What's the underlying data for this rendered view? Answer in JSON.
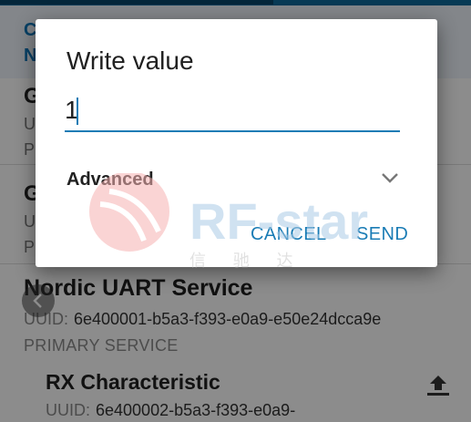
{
  "header": {
    "line1_fragment": "C",
    "line2_fragment": "N"
  },
  "background_services": [
    {
      "name_fragment": "G",
      "uuid_fragment": "U",
      "type_fragment": "P"
    },
    {
      "name_fragment": "G",
      "uuid_fragment": "U",
      "type_fragment": "P"
    }
  ],
  "service": {
    "name": "Nordic UART Service",
    "uuid_label": "UUID:",
    "uuid": "6e400001-b5a3-f393-e0a9-e50e24dcca9e",
    "type": "PRIMARY SERVICE"
  },
  "characteristic": {
    "name": "RX Characteristic",
    "uuid_label": "UUID:",
    "uuid": "6e400002-b5a3-f393-e0a9-"
  },
  "dialog": {
    "title": "Write value",
    "input_value": "1",
    "advanced_label": "Advanced",
    "cancel_label": "CANCEL",
    "send_label": "SEND"
  },
  "watermark": {
    "brand": "RF-star",
    "chinese": "信 驰 达"
  },
  "colors": {
    "accent": "#1a7cb5",
    "header_bg": "#eef5fb",
    "top_bar": "#0d6b9c"
  },
  "icons": {
    "back": "chevron-left-icon",
    "expand": "chevron-down-icon",
    "write": "upload-icon"
  }
}
